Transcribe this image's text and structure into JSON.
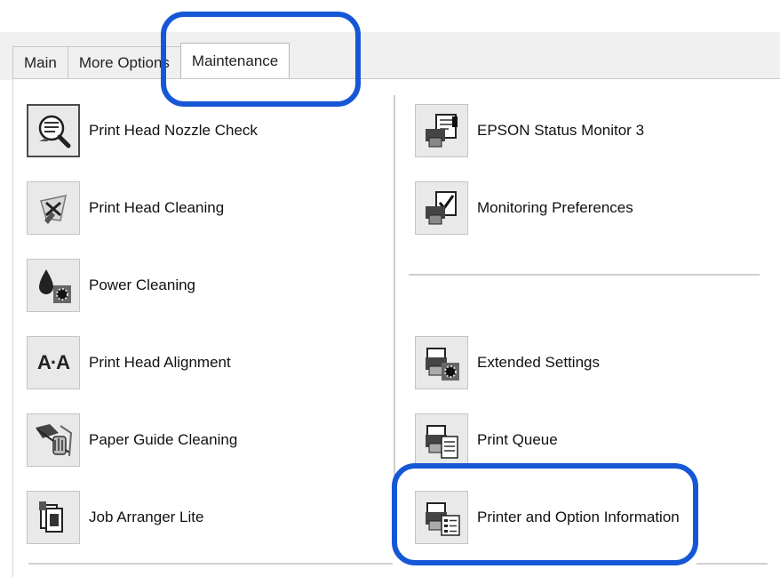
{
  "tabs": [
    {
      "label": "Main"
    },
    {
      "label": "More Options"
    },
    {
      "label": "Maintenance",
      "active": true
    }
  ],
  "left_items": [
    {
      "label": "Print Head Nozzle Check",
      "icon": "nozzle-check-icon"
    },
    {
      "label": "Print Head Cleaning",
      "icon": "head-cleaning-icon"
    },
    {
      "label": "Power Cleaning",
      "icon": "power-cleaning-icon"
    },
    {
      "label": "Print Head Alignment",
      "icon": "head-alignment-icon",
      "icon_text": "A·A"
    },
    {
      "label": "Paper Guide Cleaning",
      "icon": "paper-guide-cleaning-icon"
    },
    {
      "label": "Job Arranger Lite",
      "icon": "job-arranger-icon"
    }
  ],
  "right_items": [
    {
      "label": "EPSON Status Monitor 3",
      "icon": "status-monitor-icon"
    },
    {
      "label": "Monitoring Preferences",
      "icon": "monitoring-preferences-icon"
    },
    {
      "label": "Extended Settings",
      "icon": "extended-settings-icon"
    },
    {
      "label": "Print Queue",
      "icon": "print-queue-icon"
    },
    {
      "label": "Printer and Option Information",
      "icon": "printer-info-icon"
    }
  ],
  "colors": {
    "highlight": "#1657d6",
    "panel_bg": "#ffffff",
    "tab_bg": "#f0f0f0"
  }
}
